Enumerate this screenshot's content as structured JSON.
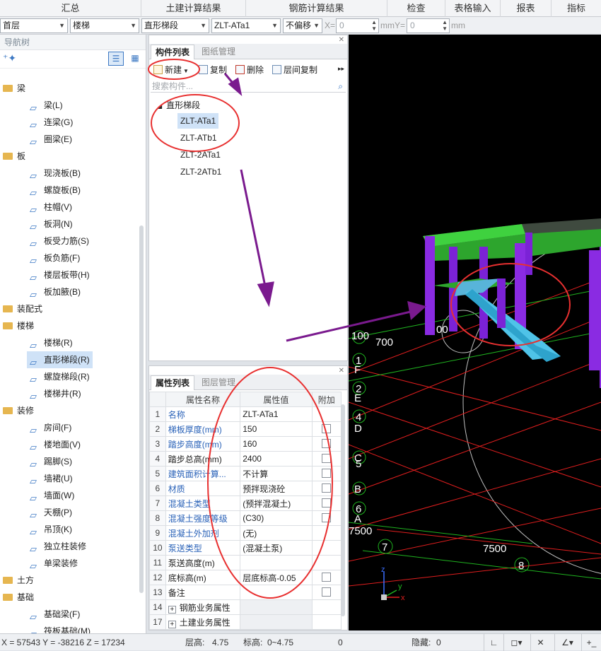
{
  "topbar": {
    "tabs": [
      "汇总",
      "土建计算结果",
      "钢筋计算结果",
      "检查",
      "表格输入",
      "报表",
      "指标"
    ]
  },
  "toolbar": {
    "floor": "首层",
    "category": "楼梯",
    "subtype": "直形梯段",
    "component": "ZLT-ATa1",
    "offset": "不偏移",
    "x_label": "X=",
    "x_value": "0",
    "y_label": "mmY=",
    "y_value": "0",
    "unit": "mm"
  },
  "nav": {
    "title": "导航树",
    "tree": [
      {
        "type": "cat",
        "label": "梁"
      },
      {
        "type": "item",
        "label": "梁(L)",
        "icon": "beam-icon"
      },
      {
        "type": "item",
        "label": "连梁(G)",
        "icon": "coupling-beam-icon"
      },
      {
        "type": "item",
        "label": "圈梁(E)",
        "icon": "ring-beam-icon"
      },
      {
        "type": "cat",
        "label": "板"
      },
      {
        "type": "item",
        "label": "现浇板(B)",
        "icon": "slab-icon"
      },
      {
        "type": "item",
        "label": "螺旋板(B)",
        "icon": "spiral-slab-icon"
      },
      {
        "type": "item",
        "label": "柱帽(V)",
        "icon": "column-cap-icon"
      },
      {
        "type": "item",
        "label": "板洞(N)",
        "icon": "slab-hole-icon"
      },
      {
        "type": "item",
        "label": "板受力筋(S)",
        "icon": "slab-rebar-icon"
      },
      {
        "type": "item",
        "label": "板负筋(F)",
        "icon": "slab-neg-rebar-icon"
      },
      {
        "type": "item",
        "label": "楼层板带(H)",
        "icon": "slab-strip-icon"
      },
      {
        "type": "item",
        "label": "板加腋(B)",
        "icon": "slab-haunch-icon"
      },
      {
        "type": "cat",
        "label": "装配式"
      },
      {
        "type": "cat",
        "label": "楼梯"
      },
      {
        "type": "item",
        "label": "楼梯(R)",
        "icon": "stair-icon"
      },
      {
        "type": "item",
        "label": "直形梯段(R)",
        "icon": "straight-flight-icon",
        "selected": true
      },
      {
        "type": "item",
        "label": "螺旋梯段(R)",
        "icon": "spiral-flight-icon"
      },
      {
        "type": "item",
        "label": "楼梯井(R)",
        "icon": "stairwell-icon"
      },
      {
        "type": "cat",
        "label": "装修"
      },
      {
        "type": "item",
        "label": "房间(F)",
        "icon": "room-icon"
      },
      {
        "type": "item",
        "label": "楼地面(V)",
        "icon": "floor-finish-icon"
      },
      {
        "type": "item",
        "label": "踢脚(S)",
        "icon": "skirting-icon"
      },
      {
        "type": "item",
        "label": "墙裙(U)",
        "icon": "wainscot-icon"
      },
      {
        "type": "item",
        "label": "墙面(W)",
        "icon": "wall-finish-icon"
      },
      {
        "type": "item",
        "label": "天棚(P)",
        "icon": "ceiling-icon"
      },
      {
        "type": "item",
        "label": "吊顶(K)",
        "icon": "suspended-ceiling-icon"
      },
      {
        "type": "item",
        "label": "独立柱装修",
        "icon": "column-finish-icon"
      },
      {
        "type": "item",
        "label": "单梁装修",
        "icon": "beam-finish-icon"
      },
      {
        "type": "cat",
        "label": "土方"
      },
      {
        "type": "cat",
        "label": "基础"
      },
      {
        "type": "item",
        "label": "基础梁(F)",
        "icon": "foundation-beam-icon"
      },
      {
        "type": "item",
        "label": "筏板基础(M)",
        "icon": "raft-icon"
      }
    ]
  },
  "comp": {
    "tab_active": "构件列表",
    "tab_inactive": "图纸管理",
    "btn_new": "新建",
    "btn_copy": "复制",
    "btn_delete": "删除",
    "btn_floor_copy": "层间复制",
    "search_placeholder": "搜索构件...",
    "root": "直形梯段",
    "items": [
      "ZLT-ATa1",
      "ZLT-ATb1",
      "ZLT-2ATa1",
      "ZLT-2ATb1"
    ]
  },
  "props": {
    "tab_active": "属性列表",
    "tab_inactive": "图层管理",
    "col_name": "属性名称",
    "col_value": "属性值",
    "col_extra": "附加",
    "rows": [
      {
        "n": "1",
        "name": "名称",
        "value": "ZLT-ATa1",
        "blue": true,
        "cb": false
      },
      {
        "n": "2",
        "name": "梯板厚度(mm)",
        "value": "150",
        "blue": true,
        "cb": true
      },
      {
        "n": "3",
        "name": "踏步高度(mm)",
        "value": "160",
        "blue": true,
        "cb": true
      },
      {
        "n": "4",
        "name": "踏步总高(mm)",
        "value": "2400",
        "blue": false,
        "cb": true
      },
      {
        "n": "5",
        "name": "建筑面积计算...",
        "value": "不计算",
        "blue": true,
        "cb": true
      },
      {
        "n": "6",
        "name": "材质",
        "value": "预拌现浇砼",
        "blue": true,
        "cb": true
      },
      {
        "n": "7",
        "name": "混凝土类型",
        "value": "(预拌混凝土)",
        "blue": true,
        "cb": true
      },
      {
        "n": "8",
        "name": "混凝土强度等级",
        "value": "(C30)",
        "blue": true,
        "cb": true
      },
      {
        "n": "9",
        "name": "混凝土外加剂",
        "value": "(无)",
        "blue": true,
        "cb": false
      },
      {
        "n": "10",
        "name": "泵送类型",
        "value": "(混凝土泵)",
        "blue": true,
        "cb": false
      },
      {
        "n": "11",
        "name": "泵送高度(m)",
        "value": "",
        "blue": false,
        "cb": false
      },
      {
        "n": "12",
        "name": "底标高(m)",
        "value": "层底标高-0.05",
        "blue": false,
        "cb": true
      },
      {
        "n": "13",
        "name": "备注",
        "value": "",
        "blue": false,
        "cb": true
      },
      {
        "n": "14",
        "name": "钢筋业务属性",
        "value": "",
        "blue": false,
        "cb": false,
        "group": true
      },
      {
        "n": "17",
        "name": "土建业务属性",
        "value": "",
        "blue": false,
        "cb": false,
        "group": true
      }
    ]
  },
  "viewport": {
    "labels_dim": [
      "700",
      "7500",
      "7500"
    ],
    "dim_partial": "100",
    "dim_partial2": "00",
    "axis_letters": [
      "1",
      "F",
      "2",
      "E",
      "4",
      "D",
      "C",
      "5",
      "B",
      "6",
      "A"
    ],
    "axis_numbers": [
      "7",
      "8"
    ],
    "axis_x": "x",
    "axis_y": "y",
    "axis_z": "z"
  },
  "status": {
    "coords": "X = 57543 Y = -38216 Z = 17234",
    "floor_height_label": "层高:",
    "floor_height": "4.75",
    "elev_label": "标高:",
    "elev": "0~4.75",
    "zero": "0",
    "hidden_label": "隐藏:",
    "hidden": "0"
  }
}
